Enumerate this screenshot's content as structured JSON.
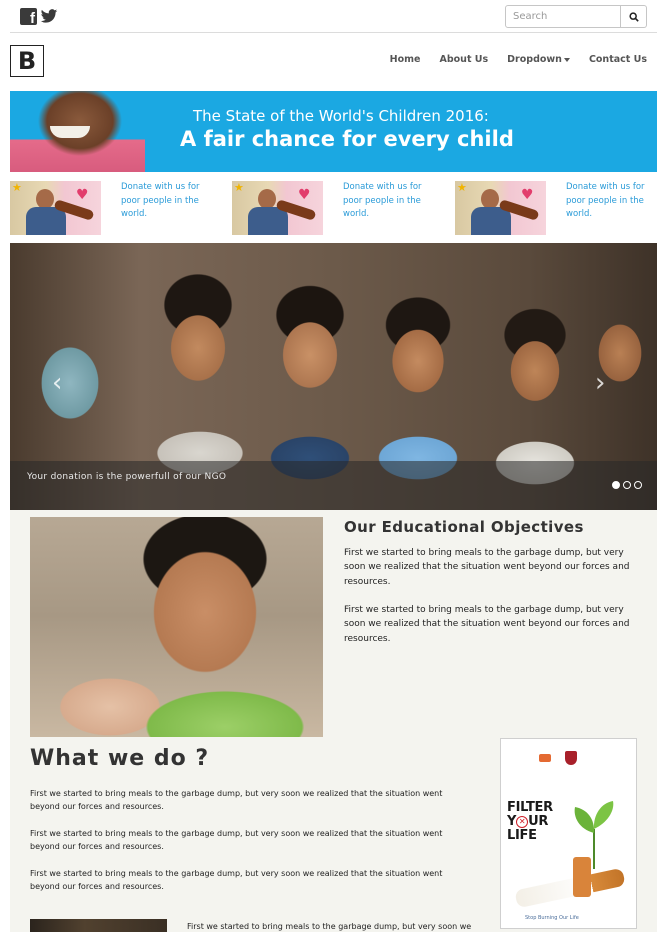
{
  "topbar": {
    "search_placeholder": "Search",
    "search_value": ""
  },
  "navbar": {
    "logo_letter": "B",
    "links": {
      "home": "Home",
      "about": "About Us",
      "dropdown": "Dropdown",
      "contact": "Contact Us"
    }
  },
  "banner": {
    "line1": "The State of the World's Children 2016:",
    "line2": "A fair chance for every child"
  },
  "donate": [
    {
      "text": "Donate with us for poor people in the world."
    },
    {
      "text": "Donate with us for poor people in the world."
    },
    {
      "text": "Donate with us for poor people in the world."
    }
  ],
  "carousel": {
    "caption": "Your donation is the powerfull of our NGO",
    "active_slide": 1,
    "slide_count": 3
  },
  "education": {
    "title": "Our Educational Objectives",
    "paragraphs": [
      "First we started to bring meals to the garbage dump, but very soon we realized that the situation went beyond our forces and resources.",
      "First we started to bring meals to the garbage dump, but very soon we realized that the situation went beyond our forces and resources."
    ]
  },
  "what_we_do": {
    "title": "What we do ?",
    "paragraphs": [
      "First we started to bring meals to the garbage dump, but very soon we realized that the situation went beyond our forces and resources.",
      "First we started to bring meals to the garbage dump, but very soon we realized that the situation went beyond our forces and resources.",
      "First we started to bring meals to the garbage dump, but very soon we realized that the situation went beyond our forces and resources."
    ],
    "bottom_text": "First we started to bring meals to the garbage dump, but very soon we"
  },
  "poster": {
    "line1": "FILTER",
    "line2_a": "Y",
    "line2_x": "✕",
    "line2_b": "UR",
    "line3": "LIFE",
    "footer": "Stop Burning Our Life"
  },
  "colors": {
    "banner_blue": "#1ba8e2",
    "donate_link": "#2a9bd8",
    "panel_bg": "#f4f4ef"
  },
  "icons": {
    "social": [
      "facebook-icon",
      "twitter-icon"
    ],
    "search": "magnifier-icon",
    "carousel_prev": "chevron-left-icon",
    "carousel_next": "chevron-right-icon"
  }
}
